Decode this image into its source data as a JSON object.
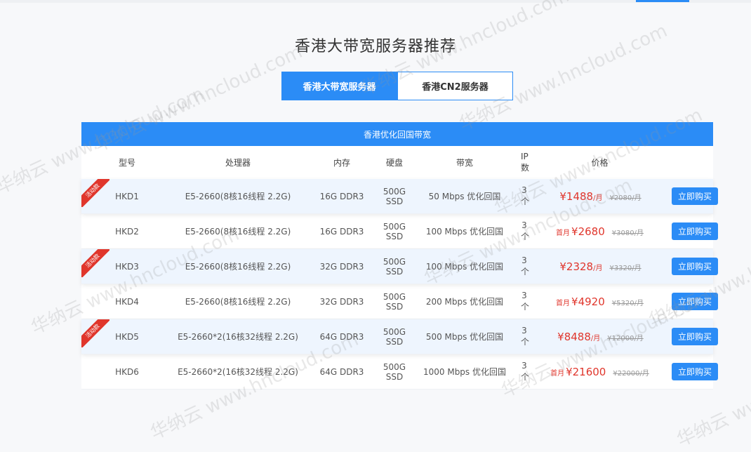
{
  "page": {
    "title": "香港大带宽服务器推荐"
  },
  "tabs": [
    {
      "label": "香港大带宽服务器",
      "active": true
    },
    {
      "label": "香港CN2服务器",
      "active": false
    }
  ],
  "table": {
    "header": "香港优化回国带宽",
    "columns": [
      "型号",
      "处理器",
      "内存",
      "硬盘",
      "带宽",
      "IP数",
      "价格",
      ""
    ],
    "buy_label": "立即购买",
    "ribbon_label": "活动款",
    "rows": [
      {
        "model": "HKD1",
        "cpu": "E5-2660(8核16线程 2.2G)",
        "mem": "16G DDR3",
        "disk": "500G SSD",
        "bw": "50 Mbps 优化回国",
        "ip": "3个",
        "prefix": "",
        "price": "¥1488",
        "unit": "/月",
        "old": "¥2080/月",
        "promo": true
      },
      {
        "model": "HKD2",
        "cpu": "E5-2660(8核16线程 2.2G)",
        "mem": "16G DDR3",
        "disk": "500G SSD",
        "bw": "100 Mbps 优化回国",
        "ip": "3个",
        "prefix": "首月",
        "price": "¥2680",
        "unit": "",
        "old": "¥3080/月",
        "promo": false
      },
      {
        "model": "HKD3",
        "cpu": "E5-2660(8核16线程 2.2G)",
        "mem": "32G DDR3",
        "disk": "500G SSD",
        "bw": "100 Mbps 优化回国",
        "ip": "3个",
        "prefix": "",
        "price": "¥2328",
        "unit": "/月",
        "old": "¥3320/月",
        "promo": true
      },
      {
        "model": "HKD4",
        "cpu": "E5-2660(8核16线程 2.2G)",
        "mem": "32G DDR3",
        "disk": "500G SSD",
        "bw": "200 Mbps 优化回国",
        "ip": "3个",
        "prefix": "首月",
        "price": "¥4920",
        "unit": "",
        "old": "¥5320/月",
        "promo": false
      },
      {
        "model": "HKD5",
        "cpu": "E5-2660*2(16核32线程 2.2G)",
        "mem": "64G DDR3",
        "disk": "500G SSD",
        "bw": "500 Mbps 优化回国",
        "ip": "3个",
        "prefix": "",
        "price": "¥8488",
        "unit": "/月",
        "old": "¥12000/月",
        "promo": true
      },
      {
        "model": "HKD6",
        "cpu": "E5-2660*2(16核32线程 2.2G)",
        "mem": "64G DDR3",
        "disk": "500G SSD",
        "bw": "1000 Mbps 优化回国",
        "ip": "3个",
        "prefix": "首月",
        "price": "¥21600",
        "unit": "",
        "old": "¥22000/月",
        "promo": false
      }
    ]
  },
  "watermark": "华纳云 www.hncloud.com"
}
